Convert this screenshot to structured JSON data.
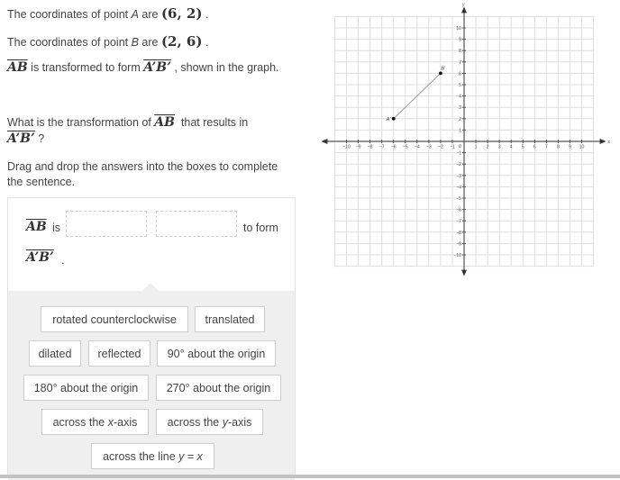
{
  "problem": {
    "line1": {
      "prefix": "The coordinates of point ",
      "point": "A",
      "mid": " are ",
      "coords": "(6, 2)",
      "suffix": " ."
    },
    "line2": {
      "prefix": "The coordinates of point ",
      "point": "B",
      "mid": " are ",
      "coords": "(2, 6)",
      "suffix": " ."
    },
    "line3": {
      "segment": "AB",
      "mid": " is transformed to form ",
      "image_segment": "A’B’",
      "suffix": " , shown in the graph."
    },
    "question": {
      "prefix": "What is the transformation of ",
      "segment": "AB",
      "mid": "  that results in ",
      "image_segment": "A’B’",
      "suffix": " ?"
    },
    "instructions": "Drag and drop the answers into the boxes to complete the sentence."
  },
  "sentence": {
    "segment": "AB",
    "is_text": "is",
    "drop_box_1": "",
    "drop_box_2": "",
    "to_form_text": "to form",
    "image_segment": "A’B’",
    "period": "."
  },
  "answer_bank": [
    {
      "text": "rotated counterclockwise"
    },
    {
      "text": "translated"
    },
    {
      "text": "dilated"
    },
    {
      "text": "reflected"
    },
    {
      "text": "90° about the origin"
    },
    {
      "text": "180° about the origin"
    },
    {
      "text": "270° about the origin"
    },
    {
      "pre": "across the ",
      "var": "x",
      "post": "-axis"
    },
    {
      "pre": "across the ",
      "var": "y",
      "post": "-axis"
    },
    {
      "pre": "across the line ",
      "var": "y",
      "mid": " = ",
      "var2": "x",
      "post": ""
    }
  ],
  "graph": {
    "x_axis_label": "x",
    "y_axis_label": "y",
    "x_range": [
      -11,
      11
    ],
    "y_range": [
      -11,
      11
    ],
    "x_ticks": [
      -10,
      -9,
      -8,
      -7,
      -6,
      -5,
      -4,
      -3,
      -2,
      -1,
      1,
      2,
      3,
      4,
      5,
      6,
      7,
      8,
      9,
      10
    ],
    "y_ticks": [
      -10,
      -9,
      -8,
      -7,
      -6,
      -5,
      -4,
      -3,
      -2,
      -1,
      1,
      2,
      3,
      4,
      5,
      6,
      7,
      8,
      9,
      10
    ],
    "origin_label": "0",
    "points": [
      {
        "label": "A'",
        "x": -6,
        "y": 2
      },
      {
        "label": "B'",
        "x": -2,
        "y": 6
      }
    ],
    "segment": [
      "A'",
      "B'"
    ],
    "grid_color": "#dddddd",
    "axis_color": "#555555"
  }
}
